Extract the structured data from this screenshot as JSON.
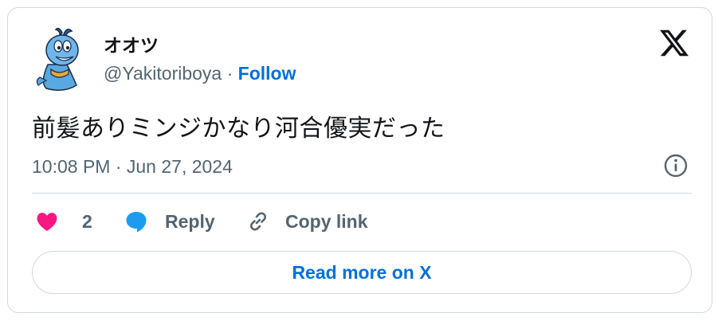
{
  "tweet": {
    "author": {
      "display_name": "オオツ",
      "handle": "@Yakitoriboya",
      "separator": " · ",
      "follow_label": "Follow",
      "avatar_icon": "cartoon-blue-bird-avatar"
    },
    "text": "前髪ありミンジかなり河合優実だった",
    "timestamp": "10:08 PM · Jun 27, 2024",
    "actions": {
      "like_count": "2",
      "reply_label": "Reply",
      "copy_link_label": "Copy link"
    },
    "read_more_label": "Read more on X"
  },
  "icons": {
    "brand": "x-logo-icon",
    "info": "info-icon",
    "like": "heart-icon",
    "reply": "speech-bubble-icon",
    "copy": "link-icon"
  },
  "colors": {
    "text_primary": "#0f1419",
    "text_secondary": "#536471",
    "link_blue": "#006fd6",
    "heart_pink": "#f91880",
    "reply_blue": "#1d9bf0",
    "border": "#cfd9de"
  }
}
